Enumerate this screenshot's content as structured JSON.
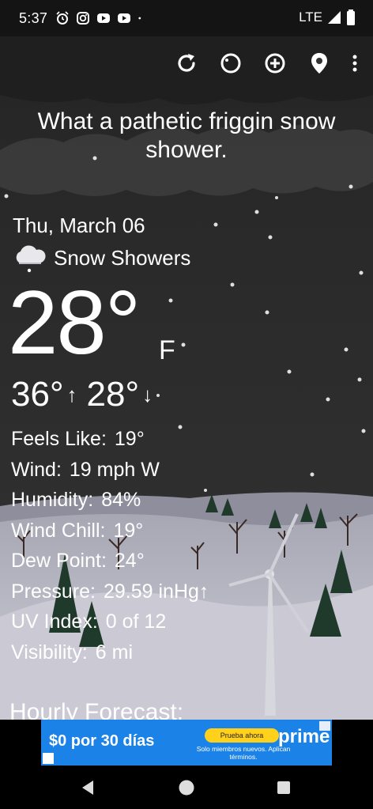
{
  "status_bar": {
    "time": "5:37",
    "network": "LTE",
    "icons": [
      "alarm-icon",
      "instagram-icon",
      "youtube-icon",
      "youtube-icon",
      "dot-icon"
    ]
  },
  "toolbar": {
    "buttons": [
      "refresh-icon",
      "theme-icon",
      "add-icon",
      "location-icon",
      "more-vert-icon"
    ]
  },
  "headline": "What a pathetic friggin snow shower.",
  "weather": {
    "date": "Thu, March 06",
    "condition": "Snow Showers",
    "temperature": "28°",
    "unit": "F",
    "high": "36°",
    "low": "28°",
    "high_arrow": "↑",
    "low_arrow": "↓"
  },
  "details": [
    {
      "label": "Feels Like:",
      "value": "19°"
    },
    {
      "label": "Wind:",
      "value": "19 mph W"
    },
    {
      "label": "Humidity:",
      "value": "84%"
    },
    {
      "label": "Wind Chill:",
      "value": "19°"
    },
    {
      "label": "Dew Point:",
      "value": "24°"
    },
    {
      "label": "Pressure:",
      "value": "29.59 inHg↑"
    },
    {
      "label": "UV Index:",
      "value": "0 of 12"
    },
    {
      "label": "Visibility:",
      "value": "6 mi"
    }
  ],
  "hourly_title": "Hourly Forecast:",
  "ad": {
    "offer": "$0 por 30 días",
    "cta": "Prueba ahora",
    "fine_print": "Solo miembros nuevos. Aplican términos.",
    "brand": "prime"
  },
  "colors": {
    "accent_ad": "#1b82e8",
    "cta": "#ffd11a",
    "sky_top": "#222222",
    "sky_bottom": "#3a3a3a",
    "snow_ground": "#c6c4d0"
  }
}
